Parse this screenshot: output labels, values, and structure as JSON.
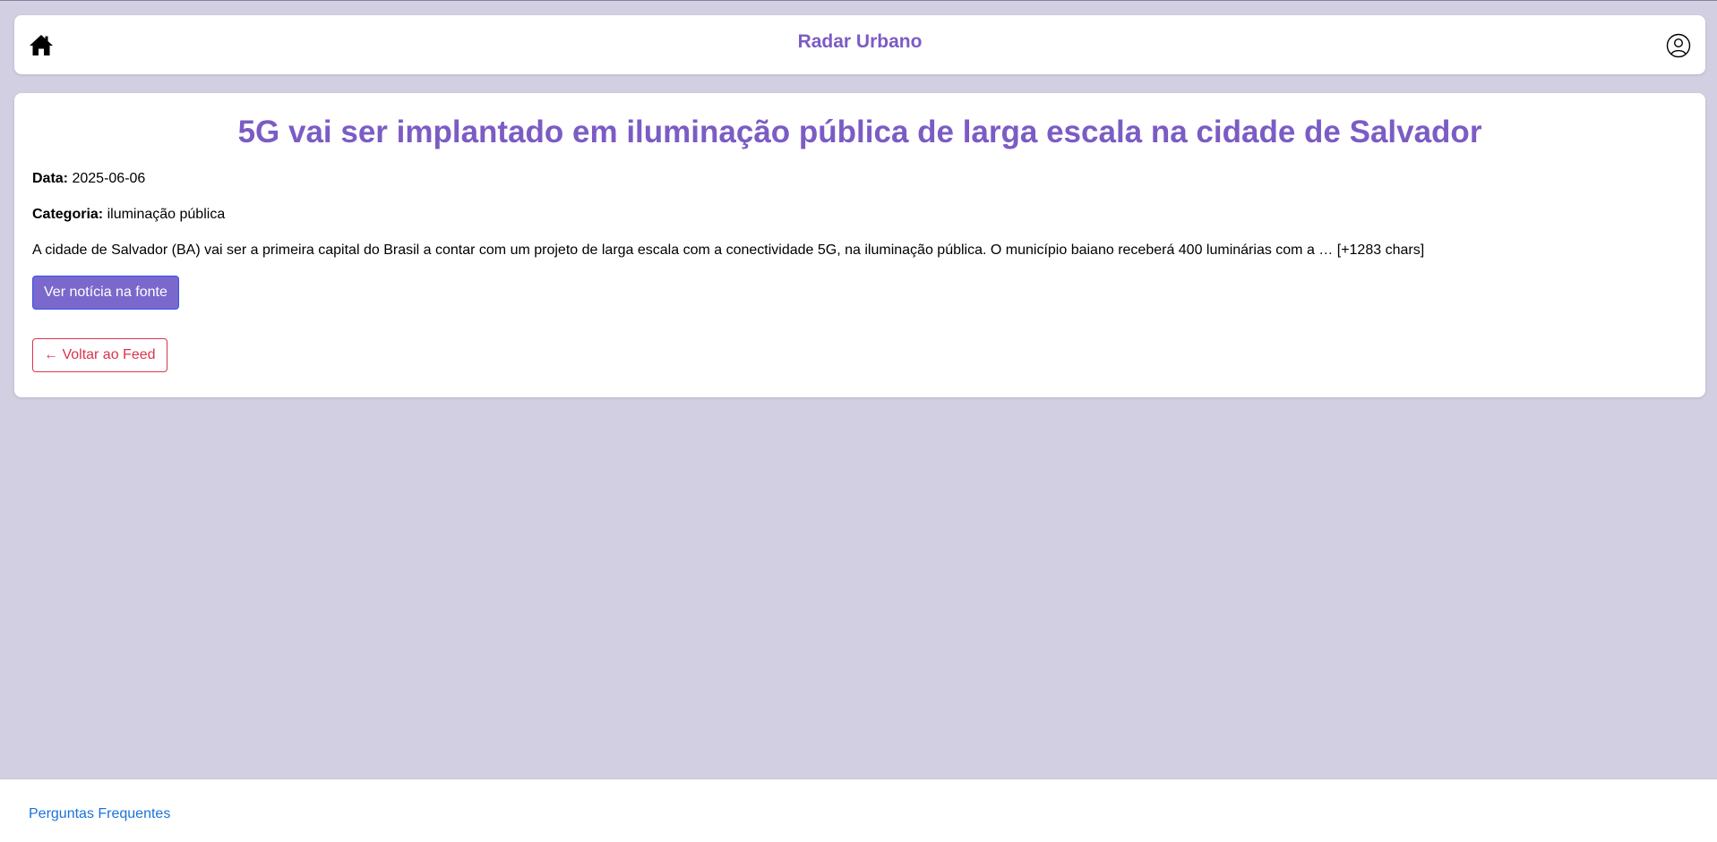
{
  "header": {
    "title": "Radar Urbano",
    "home_icon": "home-icon",
    "user_icon": "user-circle-icon"
  },
  "article": {
    "title": "5G vai ser implantado em iluminação pública de larga escala na cidade de Salvador",
    "date_label": "Data:",
    "date_value": "2025-06-06",
    "category_label": "Categoria:",
    "category_value": "iluminação pública",
    "summary": "A cidade de Salvador (BA) vai ser a primeira capital do Brasil a contar com um projeto de larga escala com a conectividade 5G, na iluminação pública. O município baiano receberá 400 luminárias com a … [+1283 chars]",
    "source_button_label": "Ver notícia na fonte",
    "back_button_label": "← Voltar ao Feed"
  },
  "footer": {
    "faq_link": "Perguntas Frequentes"
  },
  "colors": {
    "background": "#d3cfe2",
    "accent": "#7b5cc4",
    "source_button": "#7b68cc",
    "back_button": "#d9344f",
    "link": "#1a73d9"
  }
}
